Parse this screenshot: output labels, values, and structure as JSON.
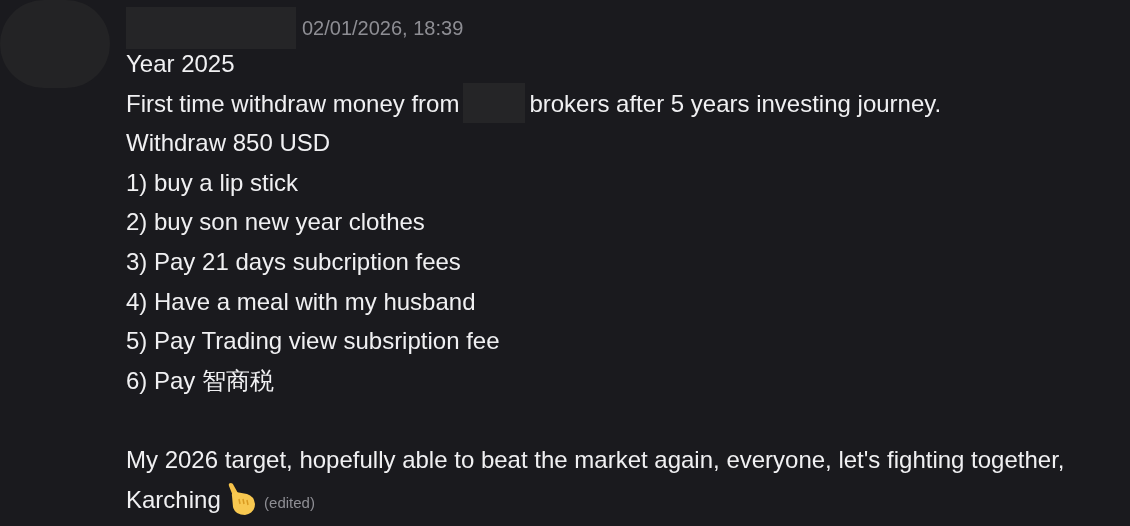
{
  "message": {
    "timestamp": "02/01/2026, 18:39",
    "lines": [
      {
        "segments": [
          "Year 2025"
        ]
      },
      {
        "segments": [
          "First time withdraw money from",
          "brokers after 5 years investing journey."
        ]
      },
      {
        "segments": [
          "Withdraw 850 USD"
        ]
      },
      {
        "segments": [
          "1) buy a lip stick"
        ]
      },
      {
        "segments": [
          "2) buy son new year clothes"
        ]
      },
      {
        "segments": [
          "3) Pay 21 days subcription fees"
        ]
      },
      {
        "segments": [
          "4) Have a meal with my husband"
        ]
      },
      {
        "segments": [
          "5) Pay Trading view subsription fee"
        ]
      },
      {
        "segments": [
          "6) Pay 智商税"
        ]
      }
    ],
    "closing": "My 2026 target, hopefully able to beat the market again, everyone, let's fighting together, Karching",
    "edited_label": "(edited)"
  }
}
